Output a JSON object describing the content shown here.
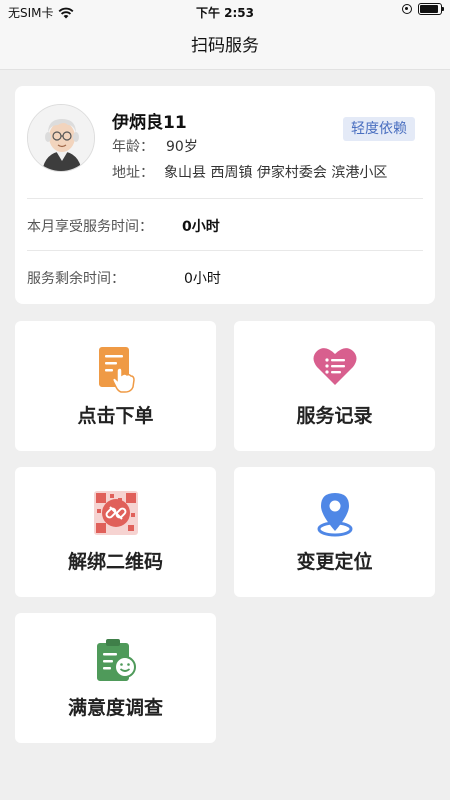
{
  "status_bar": {
    "carrier": "无SIM卡",
    "time": "下午 2:53"
  },
  "nav": {
    "title": "扫码服务"
  },
  "profile": {
    "name": "伊炳良11",
    "badge": "轻度依赖",
    "age_label": "年龄：",
    "age_value": "90岁",
    "address_label": "地址：",
    "address_value": "象山县 西周镇 伊家村委会 滨港小区",
    "month_service_label": "本月享受服务时间：",
    "month_service_value": "0小时",
    "remaining_label": "服务剩余时间：",
    "remaining_value": "0小时"
  },
  "tiles": [
    {
      "label": "点击下单",
      "icon": "order-icon",
      "color": "#ef9a45"
    },
    {
      "label": "服务记录",
      "icon": "record-heart-icon",
      "color": "#d85f8e"
    },
    {
      "label": "解绑二维码",
      "icon": "unbind-qr-icon",
      "color": "#e0605a"
    },
    {
      "label": "变更定位",
      "icon": "location-icon",
      "color": "#4f87e6"
    },
    {
      "label": "满意度调查",
      "icon": "survey-icon",
      "color": "#4f9a5a"
    }
  ]
}
